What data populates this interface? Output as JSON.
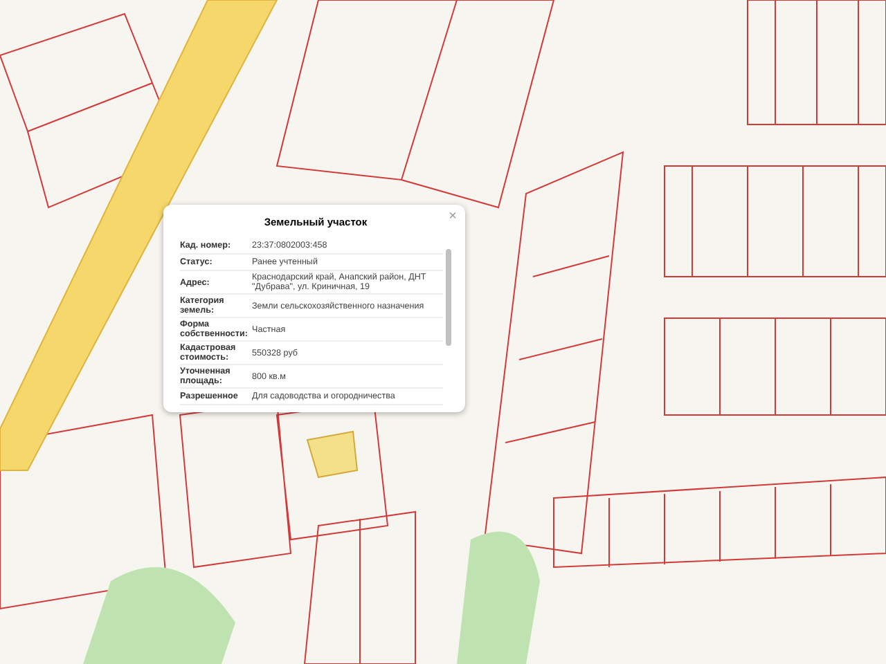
{
  "popup": {
    "title": "Земельный участок",
    "close": "×",
    "rows": [
      {
        "label": "Кад. номер:",
        "value": "23:37:0802003:458"
      },
      {
        "label": "Статус:",
        "value": "Ранее учтенный"
      },
      {
        "label": "Адрес:",
        "value": "Краснодарский край, Анапский район, ДНТ \"Дубрава\", ул. Криничная, 19"
      },
      {
        "label": "Категория земель:",
        "value": "Земли сельскохозяйственного назначения"
      },
      {
        "label": "Форма собственности:",
        "value": "Частная"
      },
      {
        "label": "Кадастровая стоимость:",
        "value": "550328 руб"
      },
      {
        "label": "Уточненная площадь:",
        "value": "800 кв.м"
      },
      {
        "label": "Разрешенное",
        "value": "Для садоводства и огородничества"
      }
    ]
  }
}
